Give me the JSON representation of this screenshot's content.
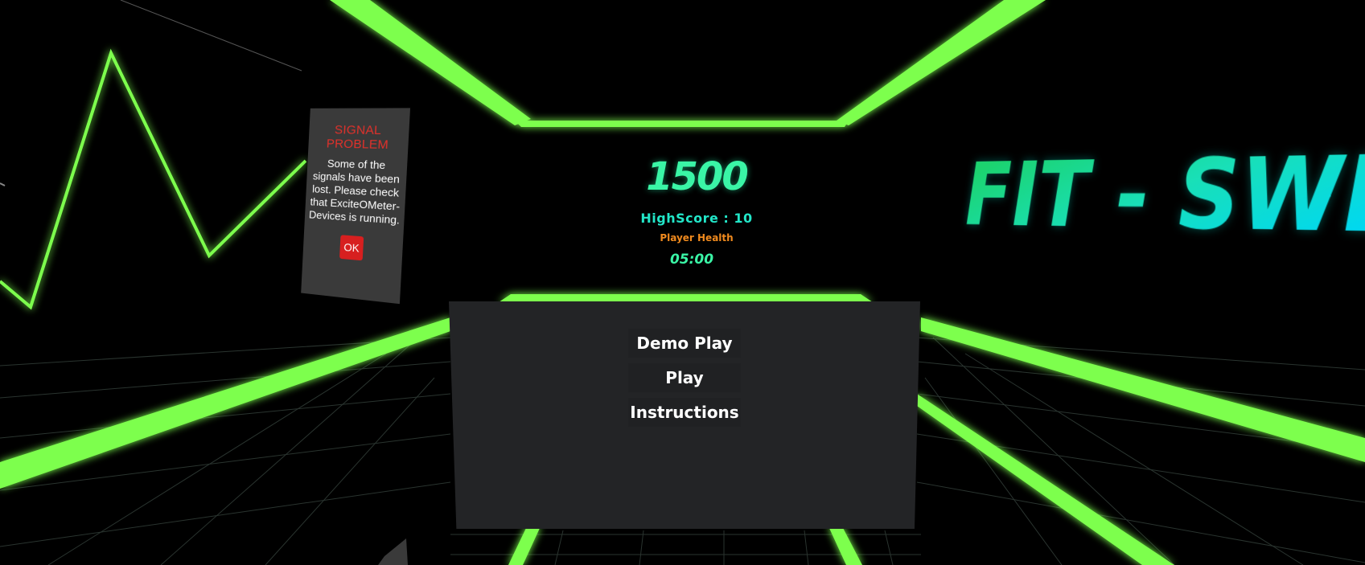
{
  "signal_problem": {
    "title": "SIGNAL PROBLEM",
    "message": "Some of the signals have been lost. Please check that ExciteOMeter-Devices is running.",
    "ok_label": "OK"
  },
  "hud": {
    "score": "1500",
    "highscore": "HighScore : 10",
    "player_health_label": "Player Health",
    "timer": "05:00"
  },
  "menu": {
    "demo_play": "Demo Play",
    "play": "Play",
    "instructions": "Instructions"
  },
  "game_title": "FIT - SWEA",
  "colors": {
    "neon_green": "#7dff4d",
    "score_teal": "#3af5a6",
    "highscore_cyan": "#22e6c8",
    "health_orange": "#f08a1e",
    "alert_red": "#e0312b",
    "panel_gray": "#232426"
  }
}
